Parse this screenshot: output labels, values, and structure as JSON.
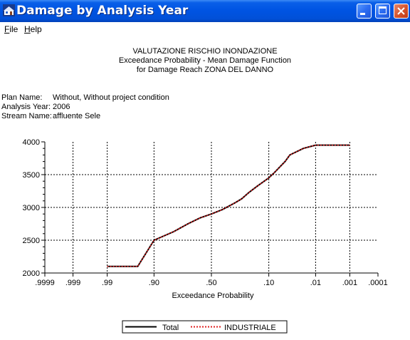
{
  "window": {
    "title": "Damage by Analysis Year",
    "app_icon": "app-icon",
    "controls": [
      "minimize-icon",
      "maximize-icon",
      "close-icon"
    ]
  },
  "menu": {
    "file_prefix": "F",
    "file_rest": "ile",
    "help_prefix": "H",
    "help_rest": "elp"
  },
  "report": {
    "line1": "VALUTAZIONE RISCHIO INONDAZIONE",
    "line2": "Exceedance Probability - Mean Damage Function",
    "line3": "for Damage Reach ZONA DEL DANNO"
  },
  "info": {
    "plan_label": "Plan Name:",
    "plan_value": "Without, Without project condition",
    "year_label": "Analysis Year:",
    "year_value": "2006",
    "stream_label": "Stream Name:",
    "stream_value": "affluente Sele"
  },
  "chart_data": {
    "type": "line",
    "xlabel": "Exceedance Probability",
    "ylabel": "",
    "x_scale": "normal-probability",
    "x_ticks": [
      ".9999",
      ".999",
      ".99",
      ".90",
      ".50",
      ".10",
      ".01",
      ".001",
      ".0001"
    ],
    "x_tick_probs": [
      0.9999,
      0.999,
      0.99,
      0.9,
      0.5,
      0.1,
      0.01,
      0.001,
      0.0001
    ],
    "y_ticks": [
      "4000",
      "3500",
      "3000",
      "2500",
      "2000"
    ],
    "ylim": [
      2000,
      4000
    ],
    "grid": true,
    "legend_position": "bottom",
    "series": [
      {
        "name": "Total",
        "color": "#000000",
        "style": "solid",
        "x": [
          0.99,
          0.95,
          0.9,
          0.8,
          0.7,
          0.6,
          0.5,
          0.4,
          0.3,
          0.25,
          0.2,
          0.15,
          0.1,
          0.08,
          0.05,
          0.04,
          0.02,
          0.01,
          0.005,
          0.001
        ],
        "y": [
          2100,
          2100,
          2500,
          2630,
          2750,
          2840,
          2900,
          2970,
          3070,
          3130,
          3230,
          3330,
          3450,
          3530,
          3700,
          3800,
          3900,
          3950,
          3950,
          3950
        ]
      },
      {
        "name": "INDUSTRIALE",
        "color": "#e02020",
        "style": "dotted",
        "x": [
          0.99,
          0.95,
          0.9,
          0.8,
          0.7,
          0.6,
          0.5,
          0.4,
          0.3,
          0.25,
          0.2,
          0.15,
          0.1,
          0.08,
          0.05,
          0.04,
          0.02,
          0.01,
          0.005,
          0.001
        ],
        "y": [
          2100,
          2100,
          2500,
          2630,
          2750,
          2840,
          2900,
          2970,
          3070,
          3130,
          3230,
          3330,
          3450,
          3530,
          3700,
          3800,
          3900,
          3950,
          3950,
          3950
        ]
      }
    ]
  }
}
